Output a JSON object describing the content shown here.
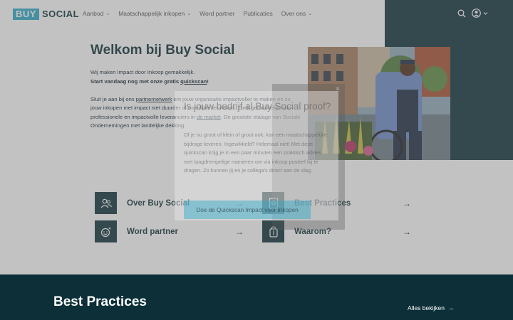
{
  "logo": {
    "part1": "BUY",
    "part2": "SOCIAL"
  },
  "nav": [
    {
      "label": "Aanbod",
      "dropdown": true
    },
    {
      "label": "Maatschappelijk inkopen",
      "dropdown": true
    },
    {
      "label": "Word partner",
      "dropdown": false
    },
    {
      "label": "Publicaties",
      "dropdown": false
    },
    {
      "label": "Over ons",
      "dropdown": true
    }
  ],
  "header_icons": [
    "search-icon",
    "user-icon",
    "chevron-down-icon"
  ],
  "hero": {
    "title": "Welkom bij Buy Social",
    "line1": "Wij maken Impact door Inkoop gemakkelijk.",
    "line2_prefix": "Start vandaag nog met onze gratis ",
    "line2_link": "quickscan",
    "line2_suffix": "!",
    "p2_a": "Sluit je aan bij ons ",
    "p2_link1": "partnernetwerk",
    "p2_b": " om jouw organisatie impactvoller te maken en zo jouw inkopen met impact niet duurder of moeilijker te maken. Zoek gemakkelijk naar professionele en impactvolle leveranciers in ",
    "p2_link2": "de market",
    "p2_c": ". De grootste etalage van Sociale Ondernemingen met landelijke dekking."
  },
  "tiles": [
    {
      "label": "Over Buy Social",
      "icon": "people-icon"
    },
    {
      "label": "Best Practices",
      "icon": "award-icon"
    },
    {
      "label": "Word partner",
      "icon": "smile-sparkle-icon"
    },
    {
      "label": "Waarom?",
      "icon": "bag-icon"
    }
  ],
  "band": {
    "title": "Best Practices",
    "link": "Alles bekijken"
  },
  "modal": {
    "title": "Is jouw bedrijf al Buy Social proof?",
    "text": "Of je nu groot of klein of groot ook, kan een maatschappelijke bijdrage leveren. Ingewikkeld? Helemaal niet! Met deze quickscan krijg je in een paar minuten een praktisch advies met laagdrempelige manieren om via inkoop positief bij te dragen. Zo kunnen jij en je collega's direct aan de slag.",
    "button": "Doe de Quickscan Impact voor Inkopen"
  },
  "colors": {
    "dark": "#0c2f38",
    "accent": "#2aa9c9"
  }
}
